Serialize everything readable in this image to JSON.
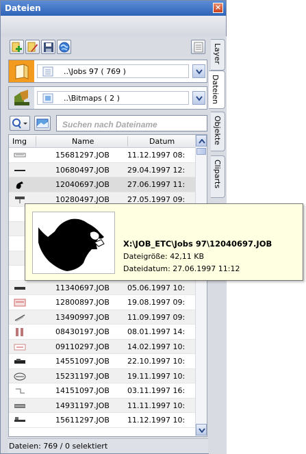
{
  "window": {
    "title": "Dateien",
    "close_glyph": "×"
  },
  "side_tabs": [
    {
      "label": "Layer",
      "active": false
    },
    {
      "label": "Dateien",
      "active": true
    },
    {
      "label": "Objekte",
      "active": false
    },
    {
      "label": "Cliparts",
      "active": false
    }
  ],
  "toolbar": {
    "buttons": [
      {
        "icon": "add-plus-icon"
      },
      {
        "icon": "edit-pen-icon"
      },
      {
        "icon": "floppy-save-icon"
      },
      {
        "icon": "globe-refresh-icon"
      }
    ],
    "view_button_icon": "list-view-icon"
  },
  "folder_combo": {
    "icon": "folder-icon",
    "value": "..\\Jobs 97  ( 769 )"
  },
  "bitmap_combo": {
    "icon": "bitmap-icon",
    "value": "..\\Bitmaps  ( 2 )"
  },
  "search": {
    "icon": "search-magnifier-icon",
    "mode_icon": "picture-icon",
    "placeholder": "Suchen nach Dateiname"
  },
  "table": {
    "headers": {
      "img": "Img",
      "name": "Name",
      "date": "Datum"
    },
    "rows": [
      {
        "name": "15681297.JOB",
        "date": "11.12.1997 08:"
      },
      {
        "name": "10680497.JOB",
        "date": "29.04.1997 12:"
      },
      {
        "name": "12040697.JOB",
        "date": "27.06.1997 11:"
      },
      {
        "name": "10280497.JOB",
        "date": "27.05.1997 09:"
      },
      {
        "name": "",
        "date": ""
      },
      {
        "name": "",
        "date": ""
      },
      {
        "name": "",
        "date": ""
      },
      {
        "name": "",
        "date": ""
      },
      {
        "name": "",
        "date": ""
      },
      {
        "name": "11340697.JOB",
        "date": "05.06.1997 10:"
      },
      {
        "name": "12800897.JOB",
        "date": "19.08.1997 09:"
      },
      {
        "name": "13490997.JOB",
        "date": "11.09.1997 09:"
      },
      {
        "name": "08430197.JOB",
        "date": "08.01.1997 14:"
      },
      {
        "name": "09110297.JOB",
        "date": "14.02.1997 10:"
      },
      {
        "name": "14551097.JOB",
        "date": "22.10.1997 10:"
      },
      {
        "name": "15231197.JOB",
        "date": "19.11.1997 10:"
      },
      {
        "name": "14151097.JOB",
        "date": "03.11.1997 16:"
      },
      {
        "name": "14931197.JOB",
        "date": "11.11.1997 10:"
      },
      {
        "name": "15611297.JOB",
        "date": "11.12.1997 10:"
      }
    ]
  },
  "status_bar": {
    "text": "Dateien: 769 / 0 selektiert"
  },
  "tooltip": {
    "path": "X:\\JOB_ETC\\Jobs 97\\12040697.JOB",
    "size": "Dateigröße: 42,11 KB",
    "date": "Dateidatum: 27.06.1997 11:12"
  }
}
